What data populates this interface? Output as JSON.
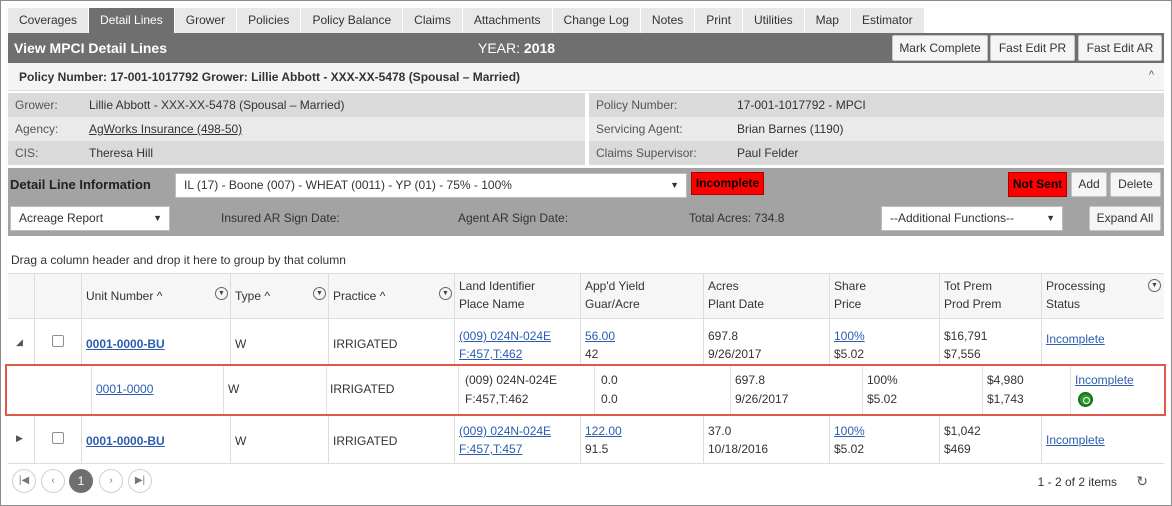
{
  "tabs": [
    "Coverages",
    "Detail Lines",
    "Grower",
    "Policies",
    "Policy Balance",
    "Claims",
    "Attachments",
    "Change Log",
    "Notes",
    "Print",
    "Utilities",
    "Map",
    "Estimator"
  ],
  "header": {
    "title": "View MPCI Detail Lines",
    "year_label": "YEAR:",
    "year_value": "2018",
    "mark_complete": "Mark Complete",
    "fast_edit_pr": "Fast Edit PR",
    "fast_edit_ar": "Fast Edit AR"
  },
  "policy_bar": {
    "title": "Policy Number: 17-001-1017792 Grower: Lillie Abbott - XXX-XX-5478 (Spousal – Married)",
    "caret": "^"
  },
  "info": {
    "grower_label": "Grower:",
    "grower_value": "Lillie Abbott - XXX-XX-5478 (Spousal – Married)",
    "agency_label": "Agency:",
    "agency_value": "AgWorks Insurance (498-50)",
    "cis_label": "CIS:",
    "cis_value": "Theresa Hill",
    "policy_label": "Policy Number:",
    "policy_value": "17-001-1017792 - MPCI",
    "servicing_label": "Servicing Agent:",
    "servicing_value": "Brian Barnes (1190)",
    "claims_label": "Claims Supervisor:",
    "claims_value": "Paul Felder"
  },
  "detail": {
    "title": "Detail Line Information",
    "line_select": "IL (17) - Boone (007) - WHEAT (0011) - YP (01) - 75% - 100%",
    "status_badge": "Incomplete",
    "sent_badge": "Not Sent",
    "add": "Add",
    "delete": "Delete",
    "report_select": "Acreage Report",
    "insured_sign": "Insured AR Sign Date:",
    "agent_sign": "Agent AR Sign Date:",
    "total_acres": "Total Acres: 734.8",
    "additional": "--Additional Functions--",
    "expand_all": "Expand All"
  },
  "group_hint": "Drag a column header and drop it here to group by that column",
  "columns": {
    "unit": "Unit Number",
    "type": "Type",
    "practice": "Practice",
    "land1": "Land Identifier",
    "land2": "Place Name",
    "yield1": "App'd Yield",
    "yield2": "Guar/Acre",
    "acres1": "Acres",
    "acres2": "Plant Date",
    "share1": "Share",
    "share2": "Price",
    "prem1": "Tot Prem",
    "prem2": "Prod Prem",
    "proc1": "Processing",
    "proc2": "Status"
  },
  "rows": [
    {
      "unit": "0001-0000-BU",
      "type": "W",
      "practice": "IRRIGATED",
      "land1": "(009) 024N-024E",
      "land2": "F:457,T:462",
      "yield1": "56.00",
      "yield2": "42",
      "acres1": "697.8",
      "acres2": "9/26/2017",
      "share1": "100%",
      "share2": "$5.02",
      "prem1": "$16,791",
      "prem2": "$7,556",
      "status": "Incomplete"
    },
    {
      "unit": "0001-0000-BU",
      "type": "W",
      "practice": "IRRIGATED",
      "land1": "(009) 024N-024E",
      "land2": "F:457,T:457",
      "yield1": "122.00",
      "yield2": "91.5",
      "acres1": "37.0",
      "acres2": "10/18/2016",
      "share1": "100%",
      "share2": "$5.02",
      "prem1": "$1,042",
      "prem2": "$469",
      "status": "Incomplete"
    }
  ],
  "subrow": {
    "unit": "0001-0000",
    "type": "W",
    "practice": "IRRIGATED",
    "land1": "(009) 024N-024E",
    "land2": "F:457,T:462",
    "yield1": "0.0",
    "yield2": "0.0",
    "acres1": "697.8",
    "acres2": "9/26/2017",
    "share1": "100%",
    "share2": "$5.02",
    "prem1": "$4,980",
    "prem2": "$1,743",
    "status": "Incomplete"
  },
  "pager": {
    "current": "1",
    "summary": "1 - 2 of 2 items"
  }
}
